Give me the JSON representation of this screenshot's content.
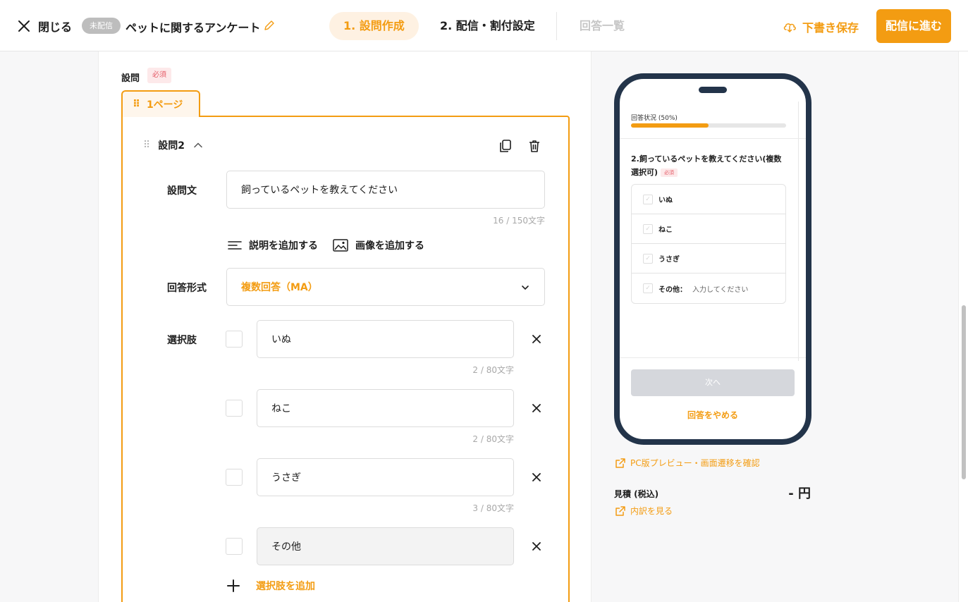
{
  "header": {
    "close_label": "閉じる",
    "status_badge": "未配信",
    "survey_title": "ペットに関するアンケート",
    "tabs": [
      {
        "label": "1. 設問作成"
      },
      {
        "label": "2. 配信・割付設定"
      },
      {
        "label": "回答一覧"
      }
    ],
    "save_draft_label": "下書き保存",
    "proceed_label": "配信に進む"
  },
  "editor": {
    "section_label": "設問",
    "required_badge": "必須",
    "page_tab_label": "1ページ",
    "question_number": "設問2",
    "question_text_label": "設問文",
    "question_text_value": "飼っているペットを教えてください",
    "question_text_counter": "16 / 150文字",
    "add_description": "説明を追加する",
    "add_image": "画像を追加する",
    "answer_format_label": "回答形式",
    "answer_format_value": "複数回答（MA）",
    "choices_label": "選択肢",
    "choices": [
      {
        "value": "いぬ",
        "counter": "2 / 80文字"
      },
      {
        "value": "ねこ",
        "counter": "2 / 80文字"
      },
      {
        "value": "うさぎ",
        "counter": "3 / 80文字"
      },
      {
        "value": "その他",
        "counter": ""
      }
    ],
    "add_choice_label": "選択肢を追加"
  },
  "preview": {
    "progress_label": "回答状況 (50%)",
    "progress_fraction": 0.5,
    "question": "2.飼っているペットを教えてください(複数選択可)",
    "required_badge": "必須",
    "choices": [
      "いぬ",
      "ねこ",
      "うさぎ"
    ],
    "other_label": "その他：",
    "other_placeholder": "入力してください",
    "next_button": "次へ",
    "quit_link": "回答をやめる"
  },
  "sidebar": {
    "pc_preview_link": "PC版プレビュー・画面遷移を確認",
    "estimate_label": "見積 (税込)",
    "estimate_value": "- 円",
    "breakdown_link": "内訳を見る"
  },
  "colors": {
    "accent": "#f39c12",
    "required": "#e55b67",
    "phone_frame": "#23344a"
  }
}
